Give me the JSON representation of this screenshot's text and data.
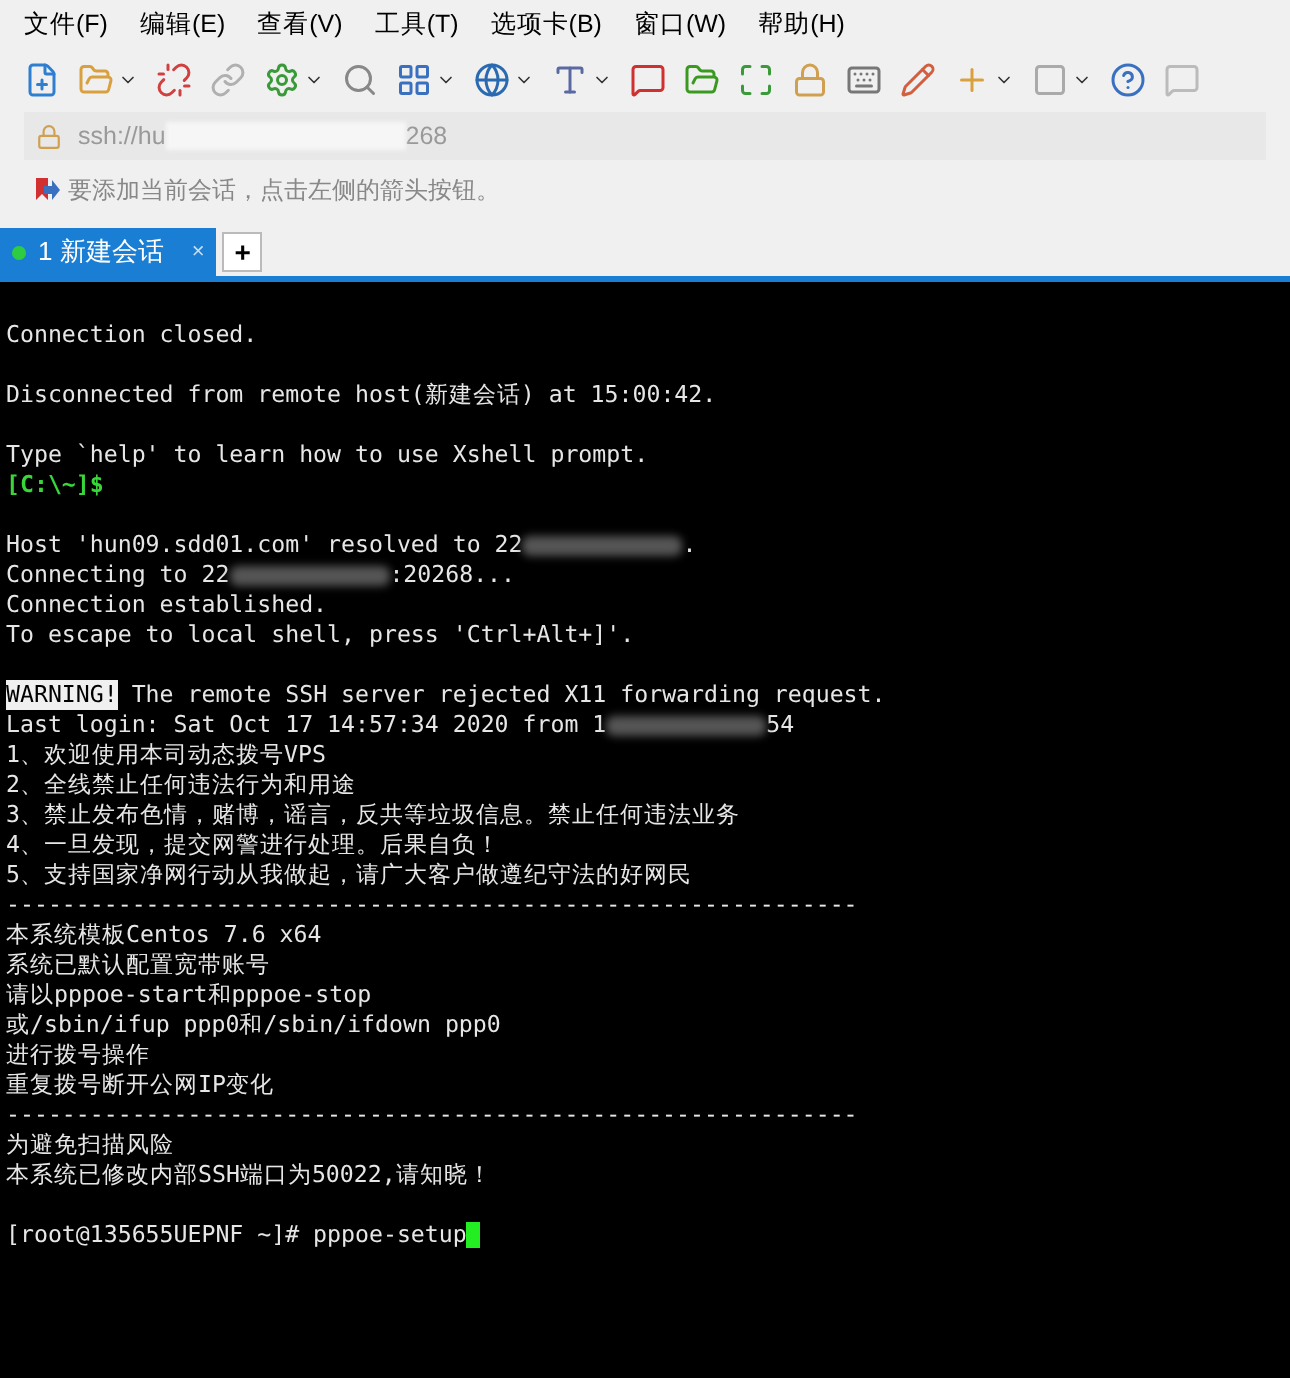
{
  "menu": [
    "文件(F)",
    "编辑(E)",
    "查看(V)",
    "工具(T)",
    "选项卡(B)",
    "窗口(W)",
    "帮助(H)"
  ],
  "address": {
    "prefix": "ssh://hu",
    "suffix": "268"
  },
  "hint": "要添加当前会话，点击左侧的箭头按钮。",
  "tabs": [
    {
      "label": "1 新建会话",
      "selected": true,
      "connected": true,
      "close": "×"
    }
  ],
  "new_tab": "+",
  "terminal": [
    {
      "kind": "line",
      "parts": [
        {
          "kind": "text",
          "text": "Connection closed."
        }
      ]
    },
    {
      "kind": "blank"
    },
    {
      "kind": "line",
      "parts": [
        {
          "kind": "text",
          "text": "Disconnected from remote host(新建会话) at 15:00:42."
        }
      ]
    },
    {
      "kind": "blank"
    },
    {
      "kind": "line",
      "parts": [
        {
          "kind": "text",
          "text": "Type `help' to learn how to use Xshell prompt."
        }
      ]
    },
    {
      "kind": "line",
      "parts": [
        {
          "kind": "prompt",
          "text": "[C:\\~]$"
        }
      ]
    },
    {
      "kind": "blank"
    },
    {
      "kind": "line",
      "parts": [
        {
          "kind": "text",
          "text": "Host 'hun09.sdd01.com' resolved to 22"
        },
        {
          "kind": "blur"
        },
        {
          "kind": "text",
          "text": "."
        }
      ]
    },
    {
      "kind": "line",
      "parts": [
        {
          "kind": "text",
          "text": "Connecting to 22"
        },
        {
          "kind": "blur"
        },
        {
          "kind": "text",
          "text": ":20268..."
        }
      ]
    },
    {
      "kind": "line",
      "parts": [
        {
          "kind": "text",
          "text": "Connection established."
        }
      ]
    },
    {
      "kind": "line",
      "parts": [
        {
          "kind": "text",
          "text": "To escape to local shell, press 'Ctrl+Alt+]'."
        }
      ]
    },
    {
      "kind": "blank"
    },
    {
      "kind": "line",
      "parts": [
        {
          "kind": "inverse",
          "text": "WARNING!"
        },
        {
          "kind": "text",
          "text": " The remote SSH server rejected X11 forwarding request."
        }
      ]
    },
    {
      "kind": "line",
      "parts": [
        {
          "kind": "text",
          "text": "Last login: Sat Oct 17 14:57:34 2020 from 1"
        },
        {
          "kind": "blur"
        },
        {
          "kind": "text",
          "text": "54"
        }
      ]
    },
    {
      "kind": "line",
      "parts": [
        {
          "kind": "text",
          "text": "1、欢迎使用本司动态拨号VPS"
        }
      ]
    },
    {
      "kind": "line",
      "parts": [
        {
          "kind": "text",
          "text": "2、全线禁止任何违法行为和用途"
        }
      ]
    },
    {
      "kind": "line",
      "parts": [
        {
          "kind": "text",
          "text": "3、禁止发布色情，赌博，谣言，反共等垃圾信息。禁止任何违法业务"
        }
      ]
    },
    {
      "kind": "line",
      "parts": [
        {
          "kind": "text",
          "text": "4、一旦发现，提交网警进行处理。后果自负！"
        }
      ]
    },
    {
      "kind": "line",
      "parts": [
        {
          "kind": "text",
          "text": "5、支持国家净网行动从我做起，请广大客户做遵纪守法的好网民"
        }
      ]
    },
    {
      "kind": "line",
      "parts": [
        {
          "kind": "text",
          "text": "-------------------------------------------------------------"
        }
      ]
    },
    {
      "kind": "line",
      "parts": [
        {
          "kind": "text",
          "text": "本系统模板Centos 7.6 x64"
        }
      ]
    },
    {
      "kind": "line",
      "parts": [
        {
          "kind": "text",
          "text": "系统已默认配置宽带账号"
        }
      ]
    },
    {
      "kind": "line",
      "parts": [
        {
          "kind": "text",
          "text": "请以pppoe-start和pppoe-stop"
        }
      ]
    },
    {
      "kind": "line",
      "parts": [
        {
          "kind": "text",
          "text": "或/sbin/ifup ppp0和/sbin/ifdown ppp0"
        }
      ]
    },
    {
      "kind": "line",
      "parts": [
        {
          "kind": "text",
          "text": "进行拨号操作"
        }
      ]
    },
    {
      "kind": "line",
      "parts": [
        {
          "kind": "text",
          "text": "重复拨号断开公网IP变化"
        }
      ]
    },
    {
      "kind": "line",
      "parts": [
        {
          "kind": "text",
          "text": "-------------------------------------------------------------"
        }
      ]
    },
    {
      "kind": "line",
      "parts": [
        {
          "kind": "text",
          "text": "为避免扫描风险"
        }
      ]
    },
    {
      "kind": "line",
      "parts": [
        {
          "kind": "text",
          "text": "本系统已修改内部SSH端口为50022,请知晓！"
        }
      ]
    },
    {
      "kind": "blank"
    },
    {
      "kind": "line",
      "parts": [
        {
          "kind": "text",
          "text": "[root@135655UEPNF ~]# pppoe-setup"
        },
        {
          "kind": "cursor"
        }
      ]
    }
  ]
}
